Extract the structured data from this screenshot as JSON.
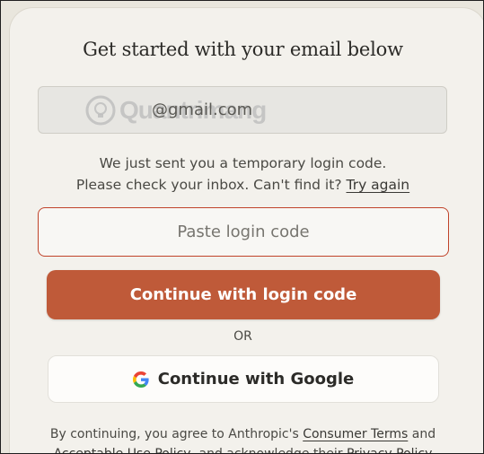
{
  "header": {
    "title": "Get started with your email below"
  },
  "email": {
    "value": "@gmail.com"
  },
  "watermark": {
    "text": "Quantrimang"
  },
  "notice": {
    "line1": "We just sent you a temporary login code.",
    "line2_prefix": "Please check your inbox. Can't find it?",
    "try_again": "Try again"
  },
  "code": {
    "placeholder": "Paste login code"
  },
  "primary_button": {
    "label": "Continue with login code"
  },
  "divider": {
    "label": "OR"
  },
  "google_button": {
    "label": "Continue with Google"
  },
  "terms": {
    "prefix": "By continuing, you agree to Anthropic's",
    "consumer_terms": "Consumer Terms",
    "and": "and",
    "acceptable_use": "Acceptable Use Policy",
    "middle": ", and acknowledge their",
    "privacy": "Privacy Policy"
  },
  "colors": {
    "accent": "#bf5a39",
    "input_error_border": "#c0432a",
    "card_bg": "#f3f1ec"
  }
}
